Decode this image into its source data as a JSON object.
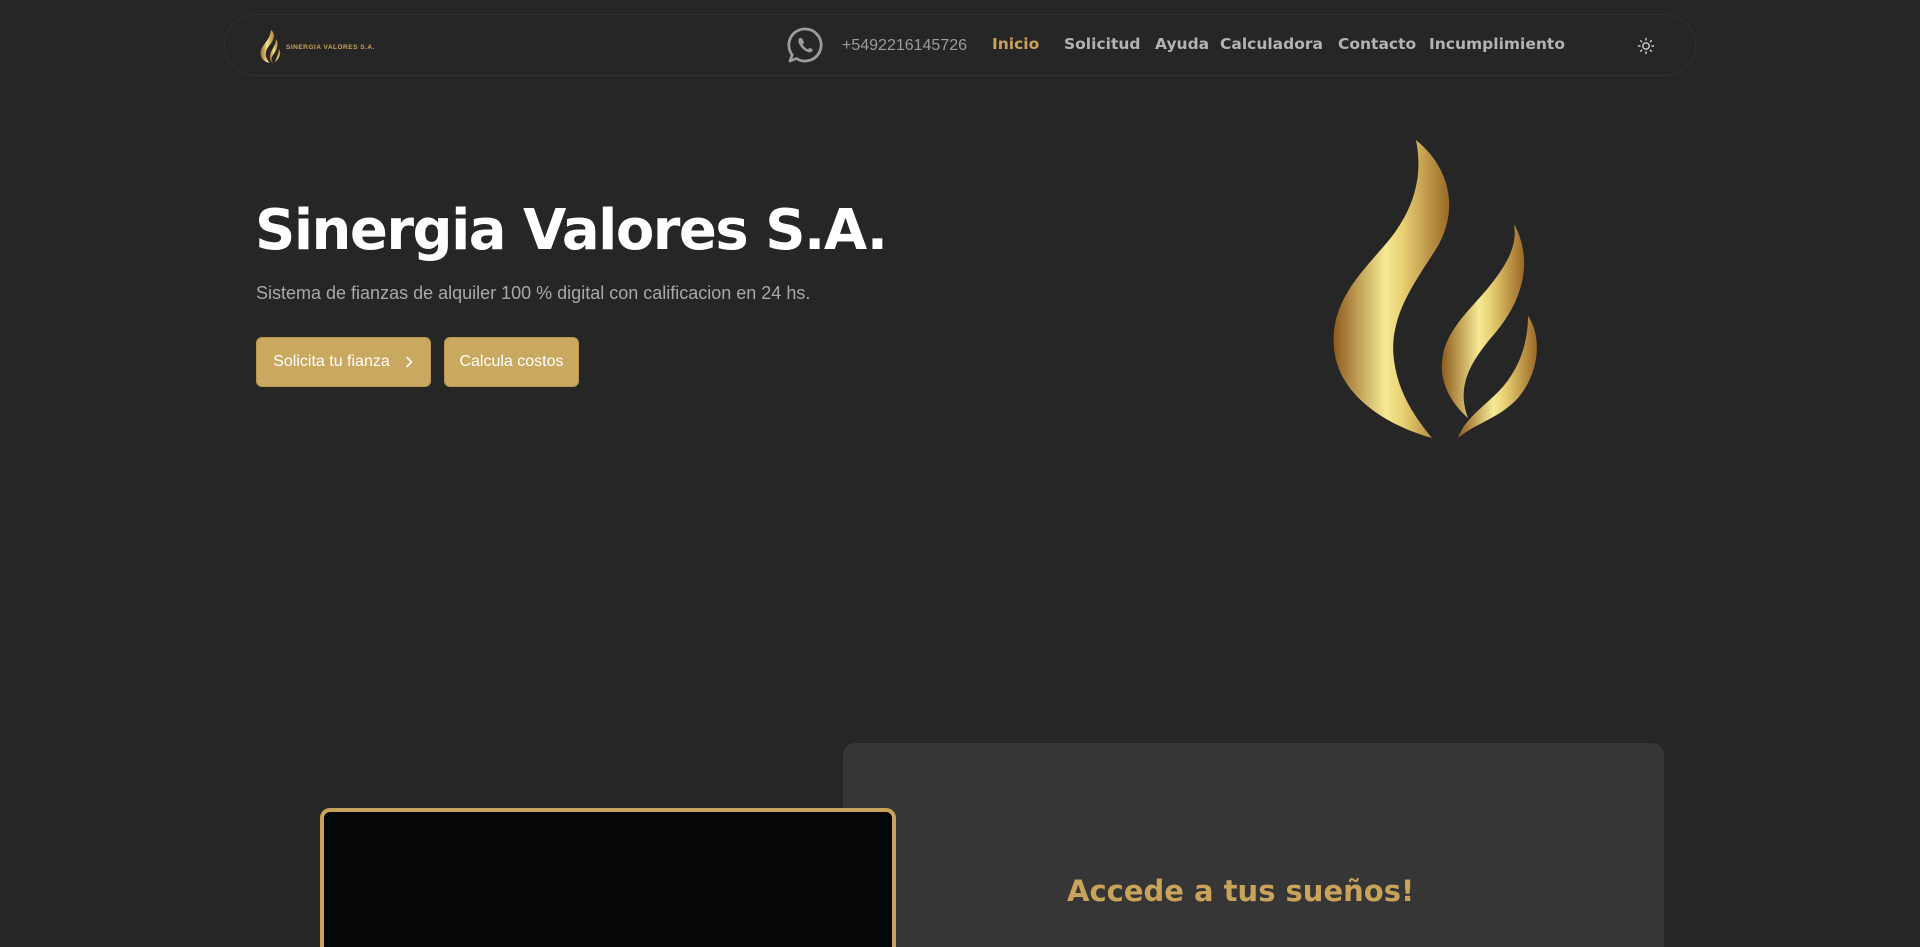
{
  "navbar": {
    "logo_text": "SINERGIA VALORES S.A.",
    "whatsapp_icon": "whatsapp-icon",
    "phone": "+5492216145726",
    "links": [
      {
        "label": "Inicio",
        "active": true
      },
      {
        "label": "Solicitud",
        "active": false
      },
      {
        "label": "Ayuda",
        "active": false
      },
      {
        "label": "Calculadora",
        "active": false
      },
      {
        "label": "Contacto",
        "active": false
      },
      {
        "label": "Incumplimiento",
        "active": false
      }
    ],
    "theme_icon": "sun-icon"
  },
  "hero": {
    "title": "Sinergia Valores S.A.",
    "subtitle": "Sistema de fianzas de alquiler 100 % digital con calificacion en 24 hs.",
    "primary_button": "Solicita tu fianza",
    "secondary_button": "Calcula costos"
  },
  "section": {
    "card_title": "Accede a tus sueños!"
  },
  "colors": {
    "background": "#262626",
    "accent_gold": "#c9a35a",
    "button_gold": "#c9a860",
    "card_bg": "#363636"
  }
}
